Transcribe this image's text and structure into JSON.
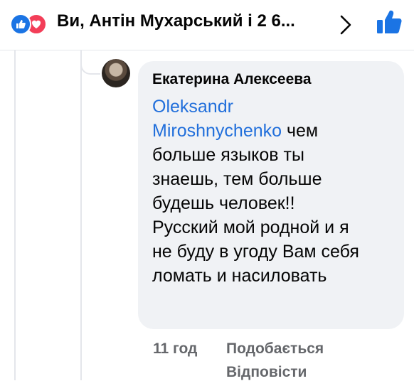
{
  "header": {
    "title": "Ви, Антін Мухарський і 2 6...",
    "reactions": [
      "like-icon",
      "love-icon"
    ],
    "chevron_icon": "chevron-right-icon",
    "like_action_icon": "thumbs-up-icon",
    "accent_color": "#1b74e4"
  },
  "comment": {
    "author": "Екатерина Алексеева",
    "mention_line1": "Oleksandr",
    "mention_line2": "Miroshnychenko",
    "text_after_mention": " чем",
    "lines": [
      "больше языков ты",
      "знаешь, тем больше",
      "будешь человек!!",
      "Русский мой родной и я",
      "не буду в угоду Вам себя",
      "ломать и насиловать"
    ],
    "time": "11 год",
    "like_label": "Подобається",
    "reply_label": "Відповісти"
  }
}
